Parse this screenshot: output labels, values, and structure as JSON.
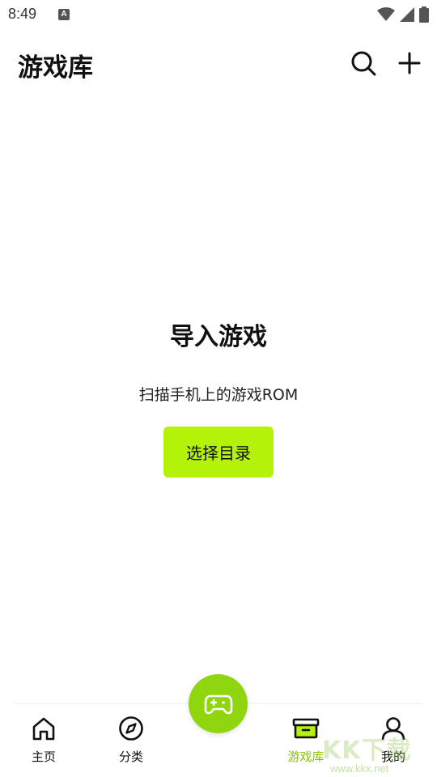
{
  "status_bar": {
    "time": "8:49",
    "app_icon_letter": "A"
  },
  "header": {
    "title": "游戏库",
    "search_icon": "search-icon",
    "add_icon": "plus-icon"
  },
  "empty_state": {
    "title": "导入游戏",
    "description": "扫描手机上的游戏ROM",
    "button_label": "选择目录"
  },
  "bottom_nav": {
    "items": [
      {
        "label": "主页",
        "icon": "home-icon",
        "active": false
      },
      {
        "label": "分类",
        "icon": "compass-icon",
        "active": false
      },
      {
        "label": "游戏库",
        "icon": "archive-box-icon",
        "active": true
      },
      {
        "label": "我的",
        "icon": "user-icon",
        "active": false
      }
    ],
    "fab_icon": "gamepad-icon"
  },
  "watermark": {
    "text": "KK下载",
    "url": "www.kkx.net"
  },
  "colors": {
    "accent": "#b5f20a",
    "fab": "#8fd60e",
    "active_label": "#86c400"
  }
}
